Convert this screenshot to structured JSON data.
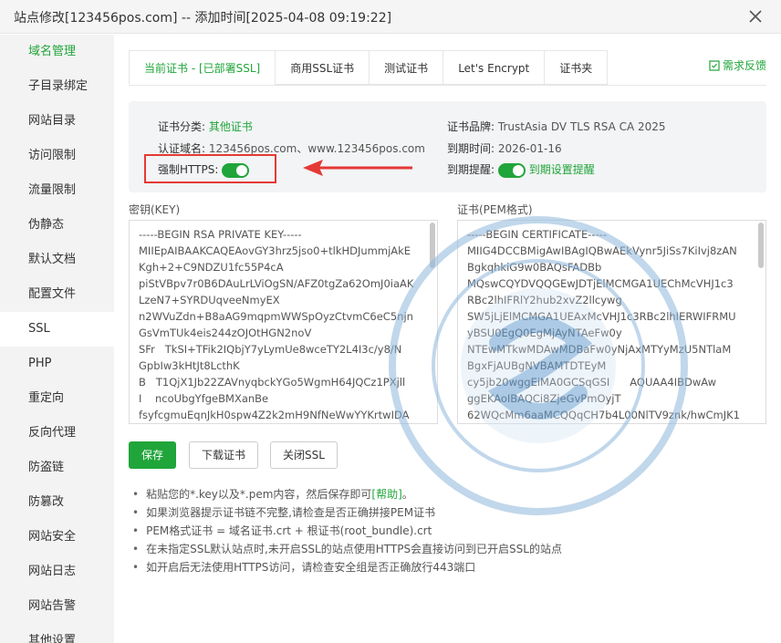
{
  "window": {
    "title": "站点修改[123456pos.com] -- 添加时间[2025-04-08 09:19:22]"
  },
  "sidebar": {
    "items": [
      {
        "label": "域名管理"
      },
      {
        "label": "子目录绑定"
      },
      {
        "label": "网站目录"
      },
      {
        "label": "访问限制"
      },
      {
        "label": "流量限制"
      },
      {
        "label": "伪静态"
      },
      {
        "label": "默认文档"
      },
      {
        "label": "配置文件"
      },
      {
        "label": "SSL"
      },
      {
        "label": "PHP"
      },
      {
        "label": "重定向"
      },
      {
        "label": "反向代理"
      },
      {
        "label": "防盗链"
      },
      {
        "label": "防篡改"
      },
      {
        "label": "网站安全"
      },
      {
        "label": "网站日志"
      },
      {
        "label": "网站告警"
      },
      {
        "label": "其他设置"
      }
    ]
  },
  "tabs": [
    {
      "label": "当前证书 - [已部署SSL]"
    },
    {
      "label": "商用SSL证书"
    },
    {
      "label": "测试证书"
    },
    {
      "label": "Let's Encrypt"
    },
    {
      "label": "证书夹"
    }
  ],
  "feedback": {
    "label": "需求反馈"
  },
  "cert_info": {
    "category_label": "证书分类:",
    "category_value": "其他证书",
    "domain_label": "认证域名:",
    "domain_value": "123456pos.com、www.123456pos.com",
    "force_https_label": "强制HTTPS:",
    "brand_label": "证书品牌:",
    "brand_value": "TrustAsia DV TLS RSA CA 2025",
    "expire_label": "到期时间:",
    "expire_value": "2026-01-16",
    "remind_label": "到期提醒:",
    "remind_link": "到期设置提醒"
  },
  "key": {
    "label": "密钥(KEY)",
    "value": "-----BEGIN RSA PRIVATE KEY-----\nMIIEpAIBAAKCAQEAovGY3hrz5jso0+tlkHDJummjAkE\nKgh+2+C9NDZU1fc55P4cA\npiStVBpv7r0B6DAuLrLViOgSN/AFZ0tgZa62OmJ0iaAK\nLzeN7+SYRDUqveeNmyEX\nn2WVuZdn+B8aAG9mqpmWWSpOyzCtvmC6eC5njn\nGsVmTUk4eis244zOJOtHGN2noV\nSFr   TkSI+TFik2IQbjY7yLymUe8wceTY2L4I3c/y8/N\nGpbIw3kHtJt8LcthK\nB   T1QjX1Jb22ZAVnyqbckYGo5WgmH64JQCz1PXjll\nI    ncoUbgYfgeBMXanBe\nfsyfcgmuEqnJkH0spw4Z2k2mH9NfNeWwYYKrtwIDA"
  },
  "cert": {
    "label": "证书(PEM格式)",
    "value": "-----BEGIN CERTIFICATE-----\nMIIG4DCCBMigAwIBAgIQBwAEkVynr5JiSs7KiIvj8zAN\nBgkqhkiG9w0BAQsFADBb\nMQswCQYDVQQGEwJDTjElMCMGA1UEChMcVHJ1c3\nRBc2lhIFRlY2hub2xvZ2llcywg\nSW5jLjElMCMGA1UEAxMcVHJ1c3RBc2lhIERWIFRMU\nyBSU0EgQ0EgMjAyNTAeFw0y\nNTEwMTkwMDAwMDBaFw0yNjAxMTYyMzU5NTlaM\nBgxFjAUBgNVBAMTDTEyM\ncy5jb20wggEiMA0GCSqGSI      AQUAA4IBDwAw\nggEKAoIBAQCi8ZjeGvPmOyjT\n62WQcMm6aaMCQQqCH7b4L00NlTV9znk/hwCmJK1"
  },
  "buttons": {
    "save": "保存",
    "download": "下载证书",
    "close_ssl": "关闭SSL"
  },
  "tips": {
    "tip1_prefix": "粘贴您的*.key以及*.pem内容，然后保存即可",
    "tip1_link": "[帮助]",
    "tip1_suffix": "。",
    "tip2": "如果浏览器提示证书链不完整,请检查是否正确拼接PEM证书",
    "tip3": "PEM格式证书 = 域名证书.crt + 根证书(root_bundle).crt",
    "tip4": "在未指定SSL默认站点时,未开启SSL的站点使用HTTPS会直接访问到已开启SSL的站点",
    "tip5": "如开启后无法使用HTTPS访问，请检查安全组是否正确放行443端口"
  },
  "colors": {
    "accent": "#20a53a",
    "highlight": "#e53935"
  }
}
